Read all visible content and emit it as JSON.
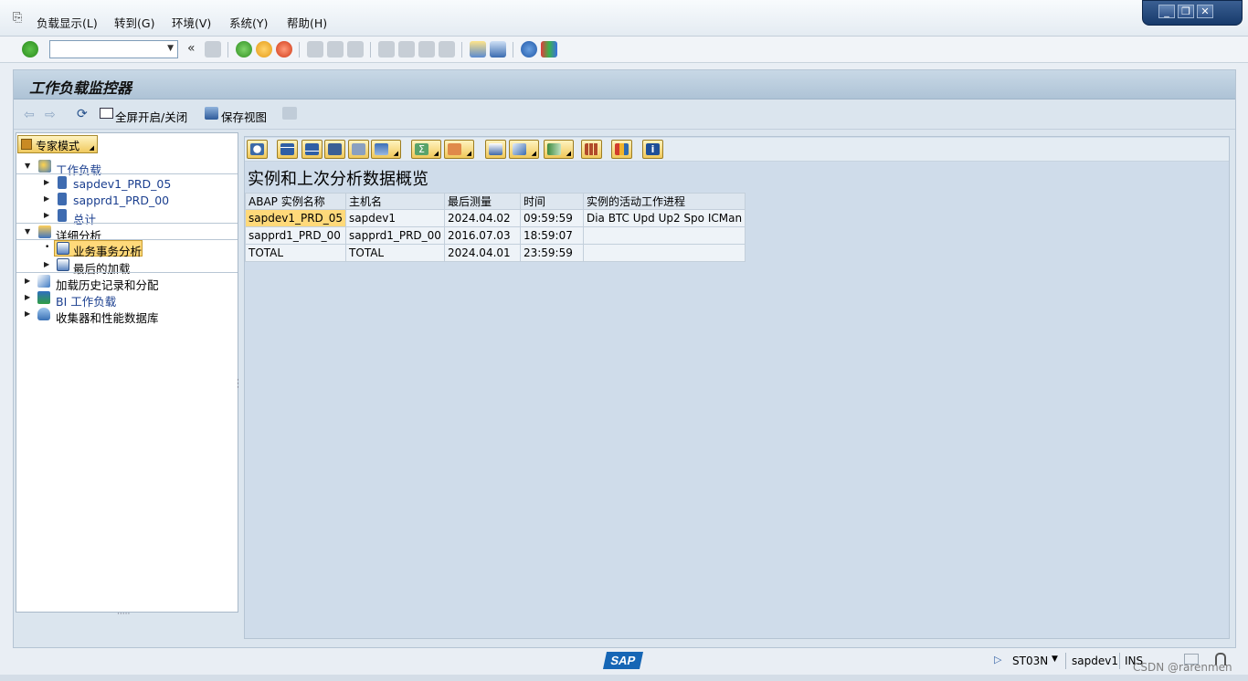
{
  "menubar": {
    "items": [
      "负载显示(L)",
      "转到(G)",
      "环境(V)",
      "系统(Y)",
      "帮助(H)"
    ]
  },
  "window_controls": {
    "minimize": "_",
    "restore": "❐",
    "close": "✕"
  },
  "page": {
    "title": "工作负载监控器"
  },
  "app_toolbar": {
    "fullscreen_label": "全屏开启/关闭",
    "save_view_label": "保存视图"
  },
  "tree": {
    "expert_mode_label": "专家模式",
    "workload": {
      "label": "工作负载",
      "children": [
        "sapdev1_PRD_05",
        "sapprd1_PRD_00",
        "总计"
      ]
    },
    "detail_analysis": {
      "label": "详细分析",
      "children": [
        "业务事务分析",
        "最后的加载"
      ]
    },
    "load_history": "加载历史记录和分配",
    "bi_workload": "BI 工作负载",
    "collector_db": "收集器和性能数据库"
  },
  "content": {
    "title": "实例和上次分析数据概览",
    "columns": [
      "ABAP 实例名称",
      "主机名",
      "最后测量",
      "时间",
      "实例的活动工作进程"
    ],
    "rows": [
      [
        "sapdev1_PRD_05",
        "sapdev1",
        "2024.04.02",
        "09:59:59",
        "Dia BTC Upd Up2 Spo ICMan"
      ],
      [
        "sapprd1_PRD_00",
        "sapprd1_PRD_00",
        "2016.07.03",
        "18:59:07",
        ""
      ],
      [
        "TOTAL",
        "TOTAL",
        "2024.04.01",
        "23:59:59",
        ""
      ]
    ]
  },
  "status": {
    "logo": "SAP",
    "transaction": "ST03N",
    "server": "sapdev1",
    "mode": "INS"
  },
  "watermark": "CSDN @rarenmen",
  "colors": {
    "accent": "#f0c85a",
    "selection": "#ffd97a",
    "title_bar": "#aec3d6"
  }
}
